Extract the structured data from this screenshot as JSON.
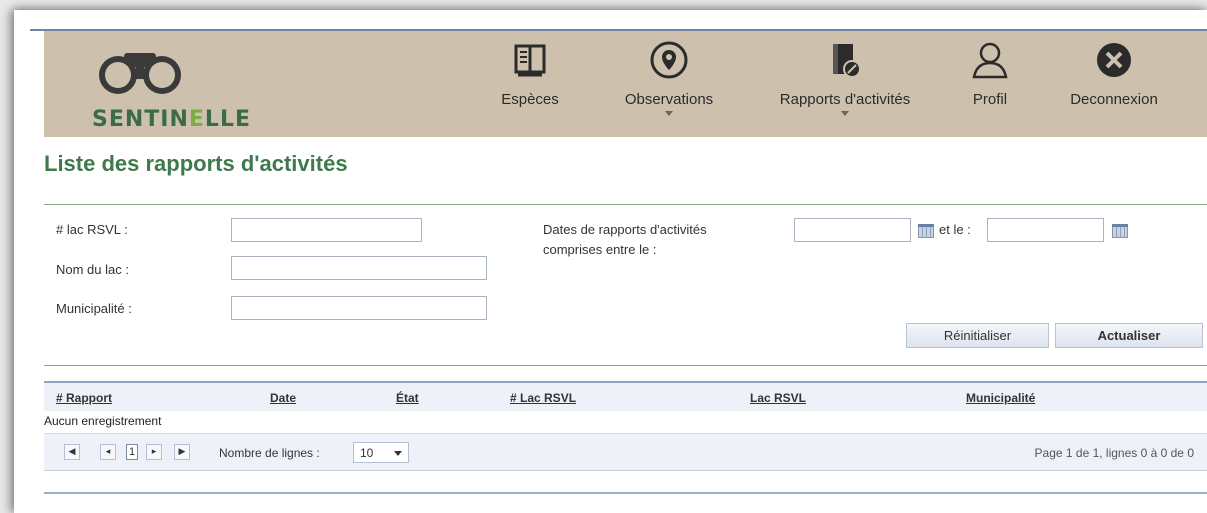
{
  "brand": {
    "name_part1": "SENTIN",
    "name_part2": "E",
    "name_part3": "LLE"
  },
  "nav": [
    {
      "label": "Espèces",
      "icon": "book-icon",
      "has_menu": false
    },
    {
      "label": "Observations",
      "icon": "location-pin-icon",
      "has_menu": true
    },
    {
      "label": "Rapports d'activités",
      "icon": "report-edit-icon",
      "has_menu": true
    },
    {
      "label": "Profil",
      "icon": "user-icon",
      "has_menu": false
    },
    {
      "label": "Deconnexion",
      "icon": "close-circle-icon",
      "has_menu": false
    }
  ],
  "page": {
    "title": "Liste des rapports d'activités"
  },
  "filters": {
    "lac_rsvl_label": "# lac RSVL :",
    "lac_rsvl_value": "",
    "nom_lac_label": "Nom du lac :",
    "nom_lac_value": "",
    "municipalite_label": "Municipalité :",
    "municipalite_value": "",
    "dates_label_line1": "Dates de rapports d'activités",
    "dates_label_line2": "comprises entre le :",
    "date_from_value": "",
    "and_label": "et le :",
    "date_to_value": ""
  },
  "actions": {
    "reset_label": "Réinitialiser",
    "refresh_label": "Actualiser"
  },
  "table": {
    "columns": [
      "# Rapport",
      "Date",
      "État",
      "# Lac RSVL",
      "Lac RSVL",
      "Municipalité"
    ],
    "empty_text": "Aucun enregistrement"
  },
  "pager": {
    "first": "⏮",
    "current_page": "1",
    "rows_label": "Nombre de lignes :",
    "rows_value": "10",
    "info": "Page 1 de 1, lignes 0 à 0 de 0"
  },
  "colors": {
    "header_bg": "#cdc1ad",
    "title_green": "#3f7a4d",
    "brand_dark": "#3c6b4a",
    "brand_light": "#7cad45"
  }
}
